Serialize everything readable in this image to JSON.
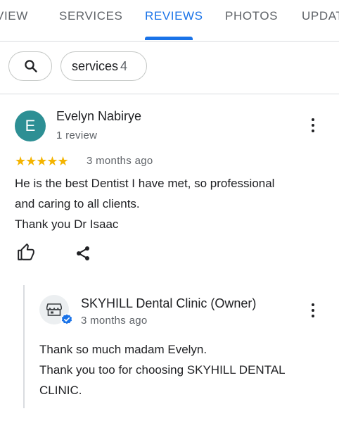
{
  "tabs": [
    {
      "label": "VIEW",
      "active": false
    },
    {
      "label": "SERVICES",
      "active": false
    },
    {
      "label": "REVIEWS",
      "active": true
    },
    {
      "label": "PHOTOS",
      "active": false
    },
    {
      "label": "UPDAT",
      "active": false
    }
  ],
  "filters": {
    "search_icon": "search-icon",
    "services_label": "services",
    "services_count": "4"
  },
  "review": {
    "avatar_letter": "E",
    "avatar_color": "#2d8f94",
    "author": "Evelyn Nabirye",
    "review_count": "1 review",
    "rating": 5,
    "stars": "★★★★★",
    "date": "3 months ago",
    "text_lines": [
      "He is the best Dentist I have met, so professional",
      "and caring to all clients.",
      "Thank you Dr Isaac"
    ]
  },
  "owner_reply": {
    "name": "SKYHILL Dental Clinic (Owner)",
    "date": "3 months ago",
    "text_lines": [
      "Thank so much madam Evelyn.",
      "Thank you too for choosing SKYHILL DENTAL",
      "CLINIC."
    ]
  },
  "colors": {
    "accent": "#1a73e8",
    "star": "#f4b400",
    "secondary_text": "#5f6368"
  }
}
